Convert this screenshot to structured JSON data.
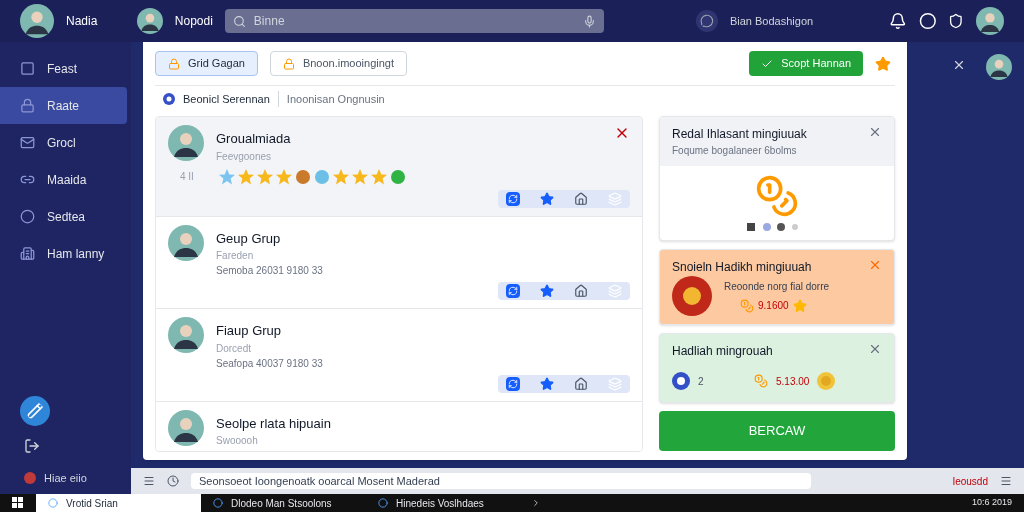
{
  "top_bar": {
    "user_name": "Nadia",
    "profile_name": "Nopodi",
    "search": {
      "placeholder": "Binne"
    },
    "account_text": "Bian Bodashigon"
  },
  "sidebar": {
    "items": [
      {
        "label": "Feast",
        "selected": false
      },
      {
        "label": "Raate",
        "selected": true
      },
      {
        "label": "Grocl",
        "selected": false
      },
      {
        "label": "Maaida",
        "selected": false
      },
      {
        "label": "Sedtea",
        "selected": false
      },
      {
        "label": "Ham lanny",
        "selected": false
      }
    ],
    "footer": "Hiae eiio"
  },
  "toolbar": {
    "buttons": [
      {
        "label": "Grid Gagan",
        "kind": "soft"
      },
      {
        "label": "Bnoon.imooingingt",
        "kind": "outline"
      },
      {
        "label": "Scopt Hannan",
        "kind": "primary"
      }
    ]
  },
  "breadcrumb": {
    "title": "Beonicl Serennan",
    "subtitle": "Inoonisan Ongnusin"
  },
  "list": {
    "items": [
      {
        "kind": "rewards",
        "name": "Groualmiada",
        "selected": true,
        "subtitle": "Feevgoones",
        "side_label": "4 II"
      },
      {
        "kind": "contact",
        "name": "Geup Grup",
        "selected": false,
        "subtitle": "Fareden",
        "detail": "Semoba 26031 9180 33"
      },
      {
        "kind": "contact",
        "name": "Fiaup Grup",
        "selected": false,
        "subtitle": "Dorcedt",
        "detail": "Seafopa 40037 9180 33"
      },
      {
        "kind": "contact",
        "name": "Seolpe rlata hipuain",
        "selected": false,
        "subtitle": "Swooooh"
      }
    ]
  },
  "cards": [
    {
      "kind": "image",
      "title": "Redal Ihlasant mingiuuak",
      "text": "Foqume bogalaneer 6bolms"
    },
    {
      "kind": "promo",
      "title": "Snoieln  Hadikh mingiuuah",
      "text": "Reoonde norg fial dorre",
      "amount": "9.1600"
    },
    {
      "kind": "reward",
      "title": "Hadliah mingrouah",
      "count": "2",
      "amount": "5.13.00"
    }
  ],
  "action_button": "BERCAW",
  "status_bar": {
    "text": "Seonsoeot Ioongenoatk ooarcal Mosent Maderad",
    "right": "Ieousdd"
  },
  "taskbar": {
    "apps": [
      "Vrotid Srian",
      "Dlodeo Man Stsoolons",
      "Hinedeis Voslhdaes"
    ],
    "clock": "10:6 2019"
  }
}
